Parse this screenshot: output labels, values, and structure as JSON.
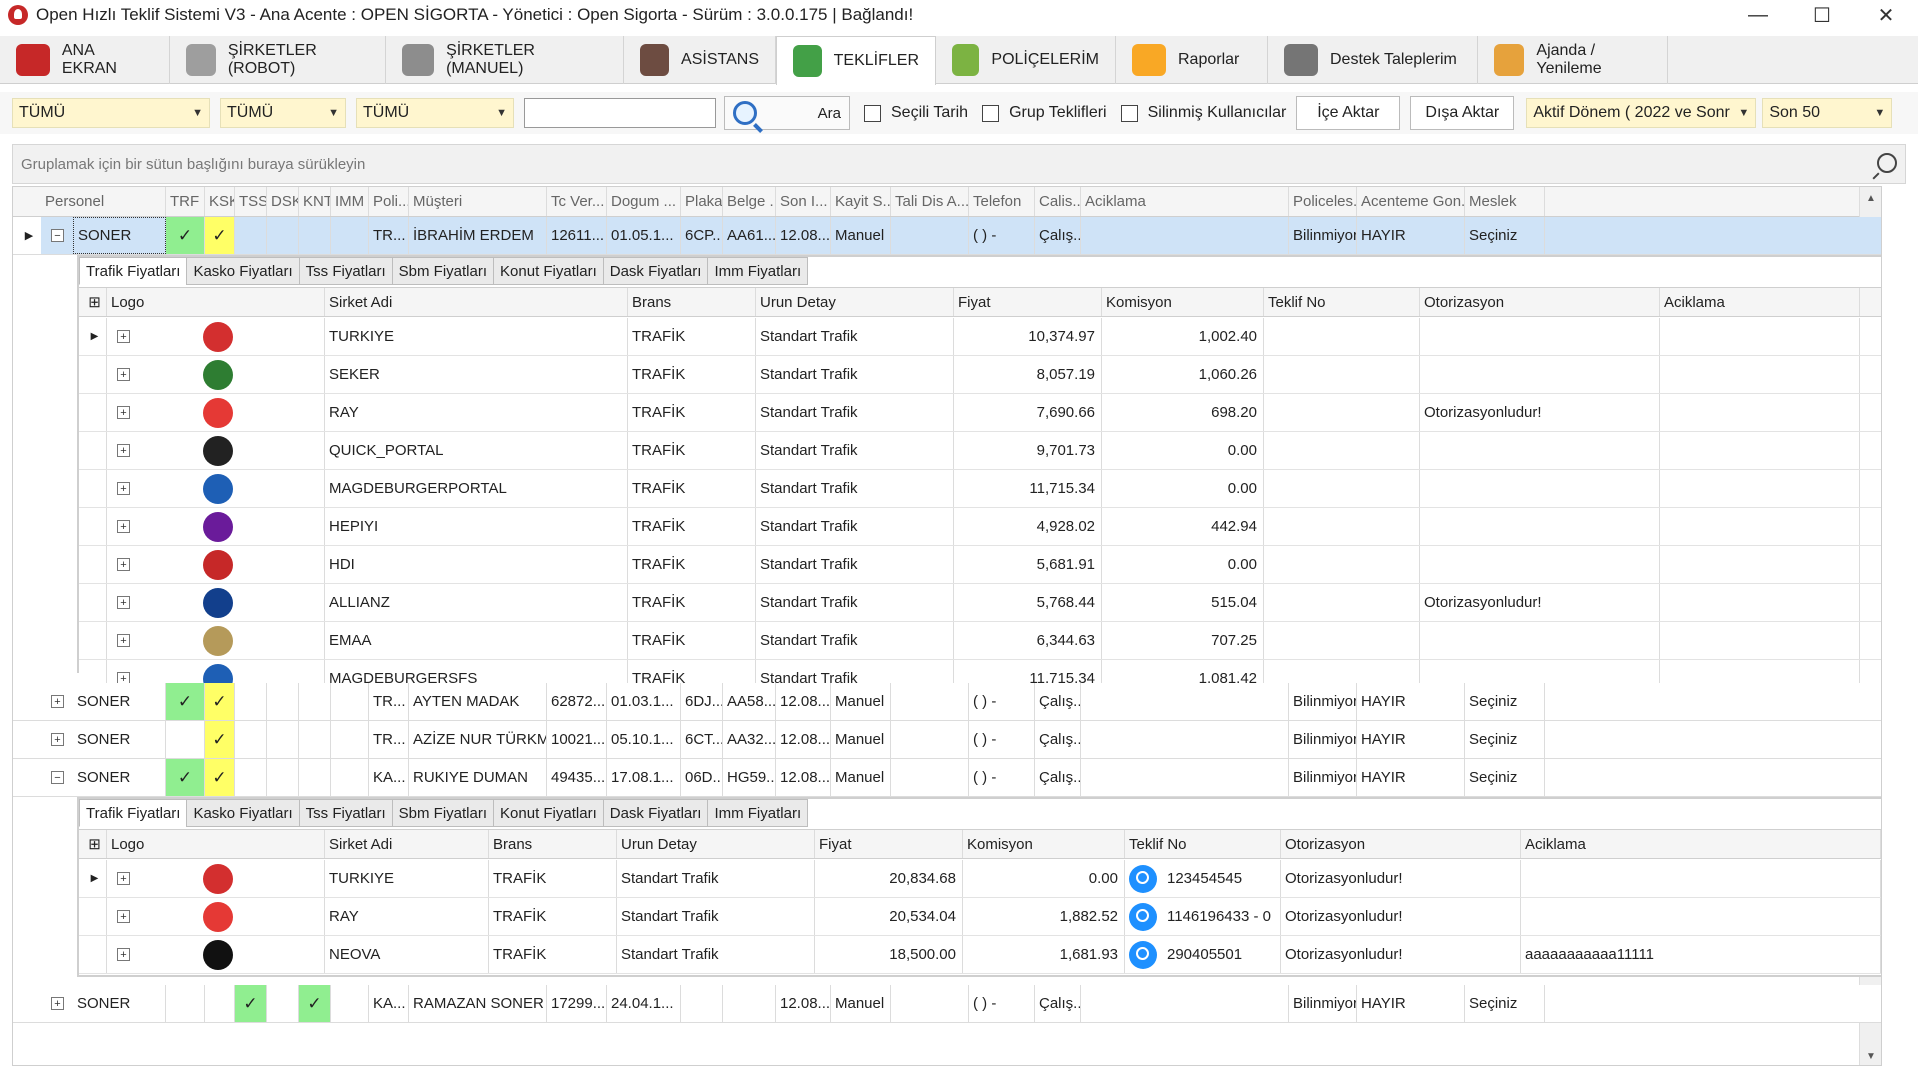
{
  "window": {
    "title": "Open Hızlı Teklif Sistemi V3 - Ana Acente : OPEN SİGORTA - Yönetici : Open Sigorta - Sürüm : 3.0.0.175 | Bağlandı!"
  },
  "tabs": [
    {
      "label": "ANA EKRAN",
      "icon": "home-icon"
    },
    {
      "label": "ŞİRKETLER (ROBOT)",
      "icon": "gear-icon"
    },
    {
      "label": "ŞİRKETLER (MANUEL)",
      "icon": "gears-icon"
    },
    {
      "label": "ASİSTANS",
      "icon": "tow-truck-icon"
    },
    {
      "label": "TEKLİFLER",
      "icon": "offers-icon"
    },
    {
      "label": "POLİÇELERİM",
      "icon": "policy-icon"
    },
    {
      "label": "Raporlar",
      "icon": "report-icon"
    },
    {
      "label": "Destek Taleplerim",
      "icon": "support-icon"
    },
    {
      "label": "Ajanda / Yenileme",
      "icon": "calendar-icon"
    }
  ],
  "filters": {
    "combo1": "TÜMÜ",
    "combo2": "TÜMÜ",
    "combo3": "TÜMÜ",
    "search_value": "",
    "search_button": "Ara",
    "secili_tarih": "Seçili Tarih",
    "grup_teklifleri": "Grup Teklifleri",
    "silinmis": "Silinmiş Kullanıcılar",
    "ice_aktar": "İçe Aktar",
    "disa_aktar": "Dışa Aktar",
    "donem": "Aktif Dönem ( 2022 ve Sonr",
    "son": "Son  50"
  },
  "group_hint": "Gruplamak için bir sütun başlığını buraya sürükleyin",
  "columns": [
    "Personel",
    "TRF",
    "KSK",
    "TSS",
    "DSK",
    "KNT",
    "IMM",
    "Poli...",
    "Müşteri",
    "Tc Ver...",
    "Dogum ...",
    "Plaka",
    "Belge ...",
    "Son I...",
    "Kayit S...",
    "Tali Dis A...",
    "Telefon",
    "Calis...",
    "Aciklama",
    "Policeles...",
    "Acenteme Gon...",
    "Meslek"
  ],
  "rows": [
    {
      "personel": "SONER",
      "trf": "✓",
      "ksk": "✓",
      "poli": "TR...",
      "musteri": "İBRAHİM ERDEM",
      "tc": "12611...",
      "dogum": "01.05.1...",
      "plaka": "6CP...",
      "belge": "AA61...",
      "son": "12.08...",
      "kayit": "Manuel",
      "telefon": "( )  -",
      "calis": "Çalış...",
      "policeles": "Bilinmiyor",
      "acente": "HAYIR",
      "meslek": "Seçiniz",
      "expand": "⊟"
    },
    {
      "personel": "SONER",
      "trf": "✓",
      "ksk": "✓",
      "poli": "TR...",
      "musteri": "AYTEN MADAK",
      "tc": "62872...",
      "dogum": "01.03.1...",
      "plaka": "6DJ...",
      "belge": "AA58...",
      "son": "12.08...",
      "kayit": "Manuel",
      "telefon": "( )  -",
      "calis": "Çalış...",
      "policeles": "Bilinmiyor",
      "acente": "HAYIR",
      "meslek": "Seçiniz",
      "expand": "⊞"
    },
    {
      "personel": "SONER",
      "trf": "",
      "ksk": "✓",
      "poli": "TR...",
      "musteri": "AZİZE NUR TÜRKMEN",
      "tc": "10021...",
      "dogum": "05.10.1...",
      "plaka": "6CT...",
      "belge": "AA32...",
      "son": "12.08...",
      "kayit": "Manuel",
      "telefon": "( )  -",
      "calis": "Çalış...",
      "policeles": "Bilinmiyor",
      "acente": "HAYIR",
      "meslek": "Seçiniz",
      "expand": "⊞"
    },
    {
      "personel": "SONER",
      "trf": "✓",
      "ksk": "✓",
      "poli": "KA...",
      "musteri": "RUKIYE DUMAN",
      "tc": "49435...",
      "dogum": "17.08.1...",
      "plaka": "06D...",
      "belge": "HG59...",
      "son": "12.08...",
      "kayit": "Manuel",
      "telefon": "( )  -",
      "calis": "Çalış...",
      "policeles": "Bilinmiyor",
      "acente": "HAYIR",
      "meslek": "Seçiniz",
      "expand": "⊟"
    },
    {
      "personel": "SONER",
      "trf": "",
      "ksk": "",
      "tss": "✓",
      "knt": "✓",
      "poli": "KA...",
      "musteri": "RAMAZAN SONER",
      "tc": "17299...",
      "dogum": "24.04.1...",
      "plaka": "",
      "belge": "",
      "son": "12.08...",
      "kayit": "Manuel",
      "telefon": "( )  -",
      "calis": "Çalış...",
      "policeles": "Bilinmiyor",
      "acente": "HAYIR",
      "meslek": "Seçiniz",
      "expand": "⊞"
    }
  ],
  "detail_tabs": [
    "Trafik Fiyatları",
    "Kasko Fiyatları",
    "Tss Fiyatları",
    "Sbm Fiyatları",
    "Konut Fiyatları",
    "Dask Fiyatları",
    "Imm Fiyatları"
  ],
  "detail_columns": [
    "Logo",
    "Sirket Adi",
    "Brans",
    "Urun Detay",
    "Fiyat",
    "Komisyon",
    "Teklif No",
    "Otorizasyon",
    "Aciklama"
  ],
  "detail1": [
    {
      "sirket": "TURKIYE",
      "brans": "TRAFİK",
      "urun": "Standart Trafik",
      "fiyat": "10,374.97",
      "komisyon": "1,002.40",
      "teklif": "",
      "otor": "",
      "acik": "",
      "logo": "turkiye-logo",
      "color": "#d32f2f"
    },
    {
      "sirket": "SEKER",
      "brans": "TRAFİK",
      "urun": "Standart Trafik",
      "fiyat": "8,057.19",
      "komisyon": "1,060.26",
      "teklif": "",
      "otor": "",
      "acik": "",
      "logo": "seker-logo",
      "color": "#2e7d32"
    },
    {
      "sirket": "RAY",
      "brans": "TRAFİK",
      "urun": "Standart Trafik",
      "fiyat": "7,690.66",
      "komisyon": "698.20",
      "teklif": "",
      "otor": "Otorizasyonludur!",
      "acik": "",
      "logo": "ray-logo",
      "color": "#e53935"
    },
    {
      "sirket": "QUICK_PORTAL",
      "brans": "TRAFİK",
      "urun": "Standart Trafik",
      "fiyat": "9,701.73",
      "komisyon": "0.00",
      "teklif": "",
      "otor": "",
      "acik": "",
      "logo": "quick-logo",
      "color": "#222222"
    },
    {
      "sirket": "MAGDEBURGERPORTAL",
      "brans": "TRAFİK",
      "urun": "Standart Trafik",
      "fiyat": "11,715.34",
      "komisyon": "0.00",
      "teklif": "",
      "otor": "",
      "acik": "",
      "logo": "magdeburger-logo",
      "color": "#1e5fb5"
    },
    {
      "sirket": "HEPIYI",
      "brans": "TRAFİK",
      "urun": "Standart Trafik",
      "fiyat": "4,928.02",
      "komisyon": "442.94",
      "teklif": "",
      "otor": "",
      "acik": "",
      "logo": "hepiyi-logo",
      "color": "#6a1b9a"
    },
    {
      "sirket": "HDI",
      "brans": "TRAFİK",
      "urun": "Standart Trafik",
      "fiyat": "5,681.91",
      "komisyon": "0.00",
      "teklif": "",
      "otor": "",
      "acik": "",
      "logo": "hdi-logo",
      "color": "#c62828"
    },
    {
      "sirket": "ALLIANZ",
      "brans": "TRAFİK",
      "urun": "Standart Trafik",
      "fiyat": "5,768.44",
      "komisyon": "515.04",
      "teklif": "",
      "otor": "Otorizasyonludur!",
      "acik": "",
      "logo": "allianz-logo",
      "color": "#123f8c"
    },
    {
      "sirket": "EMAA",
      "brans": "TRAFİK",
      "urun": "Standart Trafik",
      "fiyat": "6,344.63",
      "komisyon": "707.25",
      "teklif": "",
      "otor": "",
      "acik": "",
      "logo": "emaa-logo",
      "color": "#b59a5a"
    },
    {
      "sirket": "MAGDEBURGERSFS",
      "brans": "TRAFİK",
      "urun": "Standart Trafik",
      "fiyat": "11,715.34",
      "komisyon": "1,081.42",
      "teklif": "",
      "otor": "",
      "acik": "",
      "logo": "magdeburger-logo",
      "color": "#1e5fb5"
    }
  ],
  "detail2": [
    {
      "sirket": "TURKIYE",
      "brans": "TRAFİK",
      "urun": "Standart Trafik",
      "fiyat": "20,834.68",
      "komisyon": "0.00",
      "teklif": "123454545",
      "otor": "Otorizasyonludur!",
      "acik": "",
      "logo": "turkiye-logo",
      "color": "#d32f2f"
    },
    {
      "sirket": "RAY",
      "brans": "TRAFİK",
      "urun": "Standart Trafik",
      "fiyat": "20,534.04",
      "komisyon": "1,882.52",
      "teklif": "1146196433 - 0",
      "otor": "Otorizasyonludur!",
      "acik": "",
      "logo": "ray-logo",
      "color": "#e53935"
    },
    {
      "sirket": "NEOVA",
      "brans": "TRAFİK",
      "urun": "Standart Trafik",
      "fiyat": "18,500.00",
      "komisyon": "1,681.93",
      "teklif": "290405501",
      "otor": "Otorizasyonludur!",
      "acik": "aaaaaaaaaaa11111",
      "logo": "neova-logo",
      "color": "#111111"
    }
  ]
}
